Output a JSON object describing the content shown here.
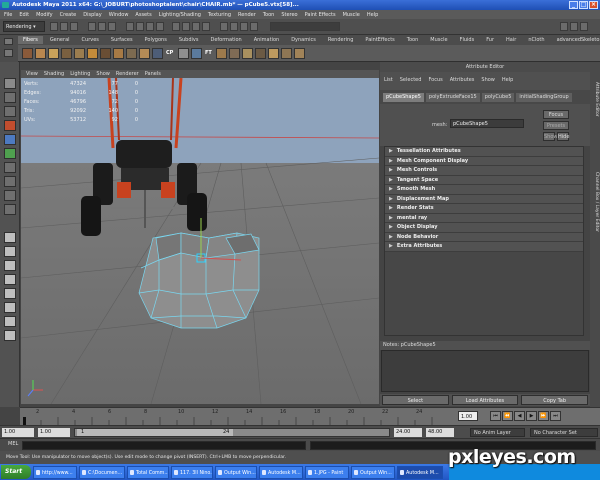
{
  "window": {
    "title": "Autodesk Maya 2011 x64: G:\\_JOBURT\\photoshoptalent\\chair\\CHAIR.mb*  —  pCube5.vtx[58]..."
  },
  "menubar": [
    "File",
    "Edit",
    "Modify",
    "Create",
    "Display",
    "Window",
    "Assets",
    "Lighting/Shading",
    "Texturing",
    "Render",
    "Toon",
    "Stereo",
    "Paint Effects",
    "Muscle",
    "Help"
  ],
  "statusline": {
    "mode": "Rendering"
  },
  "shelf": {
    "tabs": [
      "Fibers",
      "General",
      "Curves",
      "Surfaces",
      "Polygons",
      "Subdivs",
      "Deformation",
      "Animation",
      "Dynamics",
      "Rendering",
      "PaintEffects",
      "Toon",
      "Muscle",
      "Fluids",
      "Fur",
      "Hair",
      "nCloth",
      "advancedSkeleton"
    ],
    "active": 0,
    "icon_labels": [
      "CP",
      "FT"
    ]
  },
  "viewport": {
    "menu": [
      "View",
      "Shading",
      "Lighting",
      "Show",
      "Renderer",
      "Panels"
    ],
    "hud": [
      {
        "label": "Verts:",
        "value": "47324",
        "sel": "77",
        "cmp": "0"
      },
      {
        "label": "Edges:",
        "value": "94016",
        "sel": "148",
        "cmp": "0"
      },
      {
        "label": "Faces:",
        "value": "46796",
        "sel": "72",
        "cmp": "0"
      },
      {
        "label": "Tris:",
        "value": "92092",
        "sel": "140",
        "cmp": "0"
      },
      {
        "label": "UVs:",
        "value": "53712",
        "sel": "92",
        "cmp": "0"
      }
    ]
  },
  "attribute_editor": {
    "header": "Attribute Editor",
    "menu": [
      "List",
      "Selected",
      "Focus",
      "Attributes",
      "Show",
      "Help"
    ],
    "node_tabs": [
      "pCubeShape5",
      "polyExtrudeFace15",
      "polyCube5",
      "initialShadingGroup"
    ],
    "active_tab": 0,
    "mesh_label": "mesh:",
    "mesh_value": "pCubeShape5",
    "focus_button": "Focus",
    "presets_button": "Presets",
    "show_button": "Show",
    "hide_button": "Hide",
    "sections": [
      "Tessellation Attributes",
      "Mesh Component Display",
      "Mesh Controls",
      "Tangent Space",
      "Smooth Mesh",
      "Displacement Map",
      "Render Stats",
      "mental ray",
      "Object Display",
      "Node Behavior",
      "Extra Attributes"
    ],
    "notes_label": "Notes: pCubeShape5",
    "buttons": [
      "Select",
      "Load Attributes",
      "Copy Tab"
    ]
  },
  "side_tabs": [
    "Attribute Editor",
    "Channel Box / Layer Editor"
  ],
  "timeline": {
    "ticks": [
      "2",
      "4",
      "6",
      "8",
      "10",
      "12",
      "14",
      "16",
      "18",
      "20",
      "22",
      "24"
    ],
    "current_frame": "1.00",
    "range_start": "1.00",
    "range_inner_start": "1.00",
    "range_mid": "1",
    "range_mid_end": "24",
    "range_end": "24.00",
    "range_end_total": "48.00",
    "anim_layer": "No Anim Layer",
    "char_set": "No Character Set"
  },
  "mel": {
    "label": "MEL"
  },
  "helpline": {
    "text": "Move Tool: Use manipulator to move object(s). Use edit mode to change pivot (INSERT). Ctrl+LMB to move perpendicular."
  },
  "taskbar": {
    "start": "Start",
    "items": [
      "http://www...",
      "C:\\Documen...",
      "Total Comm...",
      "117. 3ll Nino...",
      "Output Win...",
      "Autodesk M...",
      "1.JPG - Paint",
      "Output Win...",
      "Autodesk M..."
    ],
    "active": 8
  },
  "watermark": "pxleyes.com"
}
